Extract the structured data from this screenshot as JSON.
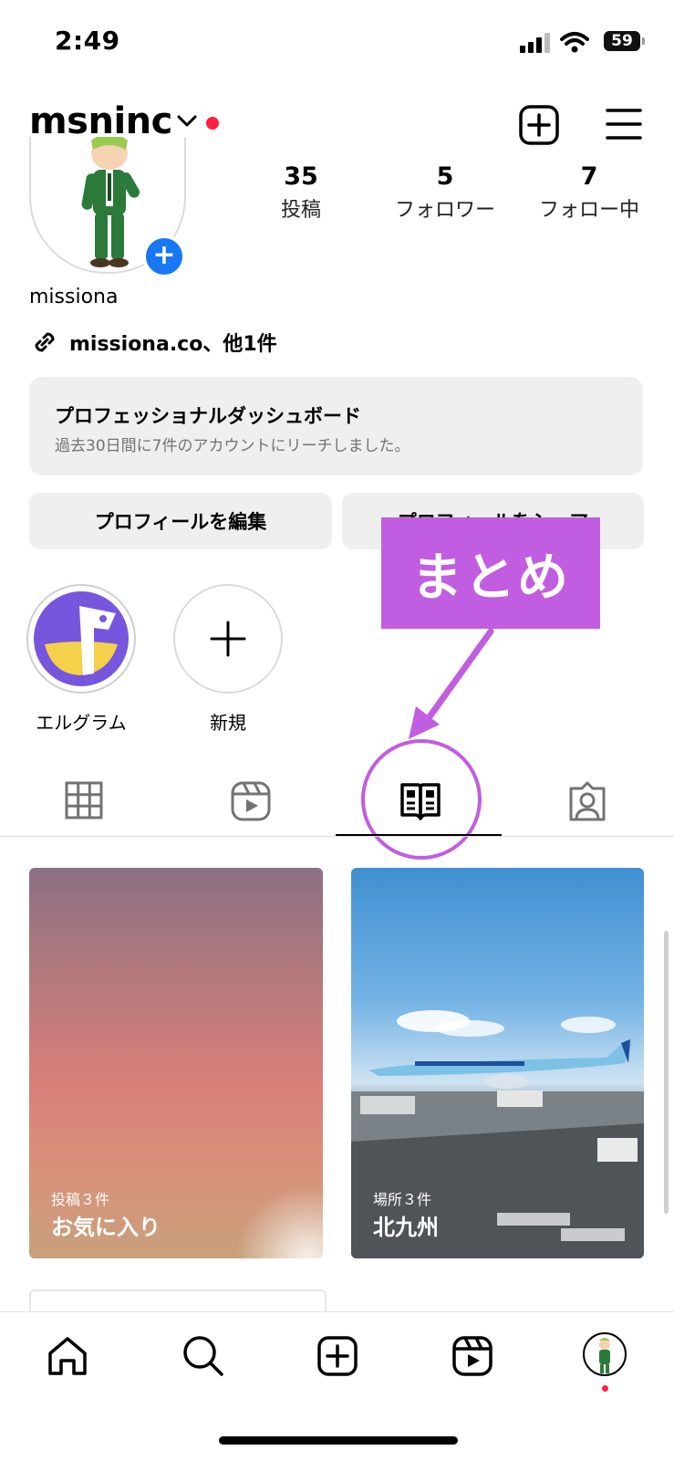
{
  "status_bar": {
    "time": "2:49",
    "battery": "59"
  },
  "header": {
    "username": "msninc"
  },
  "profile": {
    "stats": [
      {
        "value": "35",
        "label": "投稿"
      },
      {
        "value": "5",
        "label": "フォロワー"
      },
      {
        "value": "7",
        "label": "フォロー中"
      }
    ],
    "name": "missiona",
    "link": "missiona.co、他1件"
  },
  "dashboard": {
    "title": "プロフェッショナルダッシュボード",
    "subtitle": "過去30日間に7件のアカウントにリーチしました。"
  },
  "buttons": {
    "edit": "プロフィールを編集",
    "share": "プロフィールをシェア"
  },
  "highlights": [
    {
      "label": "エルグラム"
    },
    {
      "label": "新規"
    }
  ],
  "annotation": {
    "text": "まとめ"
  },
  "collections": [
    {
      "count": "投稿３件",
      "title": "お気に入り"
    },
    {
      "count": "場所３件",
      "title": "北九州"
    }
  ],
  "colors": {
    "accent": "#c15de0",
    "badge_blue": "#1877f2",
    "notification_red": "#ff1f45"
  }
}
